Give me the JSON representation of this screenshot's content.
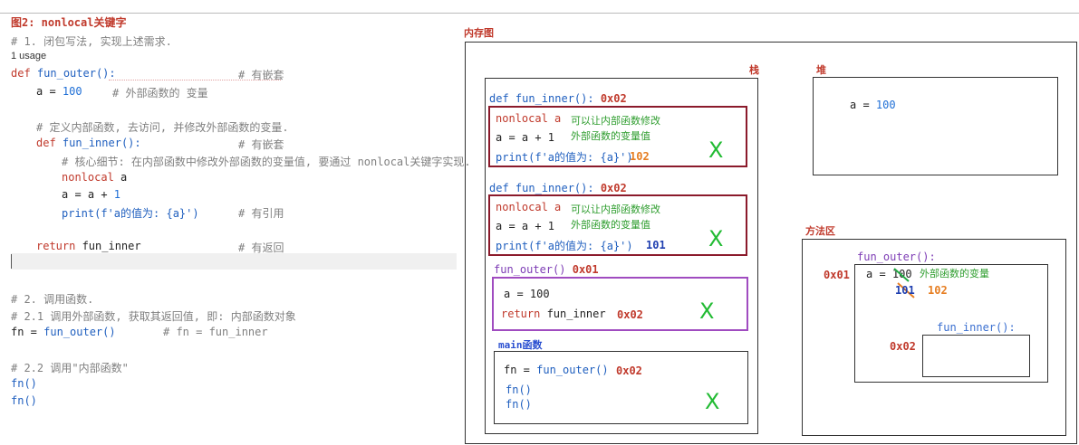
{
  "title": "图2: nonlocal关键字",
  "code": {
    "c1": "# 1. 闭包写法, 实现上述需求.",
    "usage": "1 usage",
    "def_outer_kw": "def",
    "def_outer_name": "fun_outer():",
    "def_outer_cm": "# 有嵌套",
    "a_assign": "a = ",
    "a_val": "100",
    "a_cm": "# 外部函数的 变量",
    "c_inner": "# 定义内部函数, 去访问, 并修改外部函数的变量.",
    "def_inner_kw": "def",
    "def_inner_name": "fun_inner():",
    "def_inner_cm": "# 有嵌套",
    "c_core": "# 核心细节: 在内部函数中修改外部函数的变量值, 要通过 nonlocal关键字实现.",
    "nonlocal_kw": "nonlocal",
    "nonlocal_var": " a",
    "a_inc": "a = a + ",
    "a_inc_val": "1",
    "print_fn": "print",
    "print_arg": "(f'a的值为: {a}')",
    "print_cm": "# 有引用",
    "ret_kw": "return",
    "ret_val": " fun_inner",
    "ret_cm": "# 有返回",
    "c2": "# 2. 调用函数.",
    "c21": "# 2.1 调用外部函数, 获取其返回值, 即: 内部函数对象",
    "fn_assign": "fn = ",
    "fn_call": "fun_outer()",
    "fn_cm": "# fn = fun_inner",
    "c22": "# 2.2 调用\"内部函数\"",
    "fn1": "fn()",
    "fn2": "fn()"
  },
  "diagram": {
    "memory_title": "内存图",
    "stack_label": "栈",
    "heap_label": "堆",
    "method_area_label": "方法区",
    "heap_a": "a = ",
    "heap_a_val": "100",
    "frame1": {
      "header": "def fun_inner():",
      "addr": "0x02",
      "nonlocal": "nonlocal a",
      "note1": "可以让内部函数修改",
      "note2": "外部函数的变量值",
      "inc": "a = a + 1",
      "print": "print(f'a的值为: {a}')",
      "result": "102",
      "cross": "X"
    },
    "frame2": {
      "header": "def fun_inner():",
      "addr": "0x02",
      "nonlocal": "nonlocal a",
      "note1": "可以让内部函数修改",
      "note2": "外部函数的变量值",
      "inc": "a = a + 1",
      "print": "print(f'a的值为: {a}')",
      "result": "101",
      "cross": "X"
    },
    "outer_frame": {
      "header": "fun_outer()",
      "addr": "0x01",
      "a": "a = 100",
      "ret": "return fun_inner",
      "ret_addr": "0x02",
      "cross": "X"
    },
    "main_frame": {
      "header": "main函数",
      "fn_assign": "fn = fun_outer()",
      "fn_addr": "0x02",
      "call1": "fn()",
      "call2": "fn()",
      "cross": "X"
    },
    "method": {
      "outer_label": "fun_outer():",
      "outer_addr": "0x01",
      "a_label": "a = ",
      "a_old": "100",
      "a_note": "外部函数的变量",
      "v101": "101",
      "v102": "102",
      "inner_label": "fun_inner():",
      "inner_addr": "0x02"
    }
  }
}
